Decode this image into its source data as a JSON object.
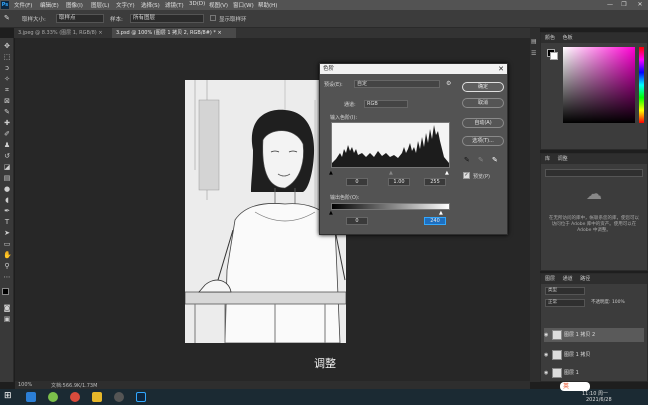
{
  "app": {
    "logo": "Ps",
    "menu": [
      "文件(F)",
      "编辑(E)",
      "图像(I)",
      "图层(L)",
      "文字(Y)",
      "选择(S)",
      "滤镜(T)",
      "3D(D)",
      "视图(V)",
      "窗口(W)",
      "帮助(H)"
    ],
    "window_buttons": [
      "—",
      "❐",
      "✕"
    ]
  },
  "options_bar": {
    "sample_size_label": "取样大小:",
    "sample_size_value": "取样点",
    "sample_label": "样本:",
    "sample_value": "所有图层",
    "show_ring_label": "显示取样环"
  },
  "tabs": [
    {
      "label": "3.jpeg @ 8.33% (图层 1, RGB/8) ×",
      "active": false
    },
    {
      "label": "3.psd @ 100% (图层 1 拷贝 2, RGB/8#) * ×",
      "active": true
    }
  ],
  "canvas": {
    "caption": "调整",
    "zoom": "100%",
    "doc_size": "文档:566.9K/1.73M"
  },
  "levels_dialog": {
    "title": "色阶",
    "preset_label": "预设(E):",
    "preset_value": "自定",
    "channel_label": "通道:",
    "channel_value": "RGB",
    "input_label": "输入色阶(I):",
    "input_black": "0",
    "input_gamma": "1.00",
    "input_white": "255",
    "output_label": "输出色阶(O):",
    "output_black": "0",
    "output_white": "240",
    "buttons": {
      "ok": "确定",
      "cancel": "取消",
      "auto": "自动(A)",
      "options": "选项(T)..."
    },
    "preview_label": "预览(P)",
    "preview_checked": true
  },
  "panels": {
    "color_tabs": [
      "颜色",
      "色板"
    ],
    "library_tabs": [
      "库",
      "调整"
    ],
    "library_text": "在无所访问的库中，帐联系您的库，使您可以访问位于 Adobe 库中的资产。使用可以在 Adobe 中调整。",
    "layers_tabs": [
      "图层",
      "通道",
      "路径"
    ],
    "layers_kind": "类型",
    "layers_blend": "正常",
    "layers_opacity": "不透明度: 100%",
    "layers": [
      {
        "name": "图层 1 拷贝 2",
        "visible": true,
        "selected": true
      },
      {
        "name": "图层 1 拷贝",
        "visible": true,
        "selected": false
      },
      {
        "name": "图层 1",
        "visible": true,
        "selected": false
      }
    ]
  },
  "taskbar": {
    "ime": "英",
    "time": "11:10 周一",
    "date": "2021/6/28"
  },
  "colors": {
    "accent": "#31a8ff",
    "dialog_bg": "#535353",
    "ui_bg": "#3c3c3c"
  }
}
